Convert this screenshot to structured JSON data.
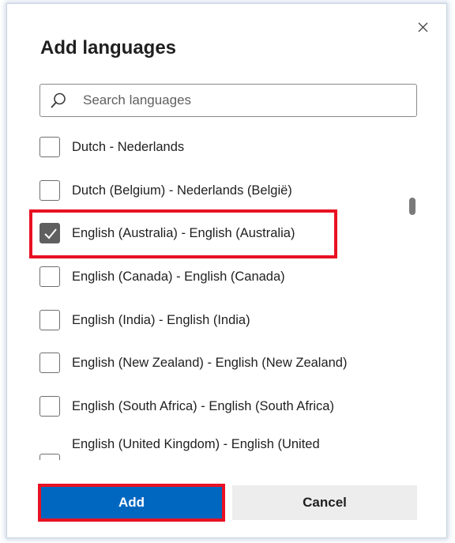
{
  "dialog": {
    "title": "Add languages",
    "close_glyph": "×"
  },
  "search": {
    "placeholder": "Search languages",
    "icon": "search-icon"
  },
  "languages": [
    {
      "label": "Dutch - Nederlands",
      "checked": false
    },
    {
      "label": "Dutch (Belgium) - Nederlands (België)",
      "checked": false
    },
    {
      "label": "English (Australia) - English (Australia)",
      "checked": true
    },
    {
      "label": "English (Canada) - English (Canada)",
      "checked": false
    },
    {
      "label": "English (India) - English (India)",
      "checked": false
    },
    {
      "label": "English (New Zealand) - English (New Zealand)",
      "checked": false
    },
    {
      "label": "English (South Africa) - English (South Africa)",
      "checked": false
    },
    {
      "label": "English (United Kingdom) - English (United",
      "checked": false
    }
  ],
  "buttons": {
    "add_label": "Add",
    "cancel_label": "Cancel"
  },
  "colors": {
    "accent": "#0067c0",
    "highlight": "#e81123",
    "checked_box": "#5f5f5f"
  }
}
